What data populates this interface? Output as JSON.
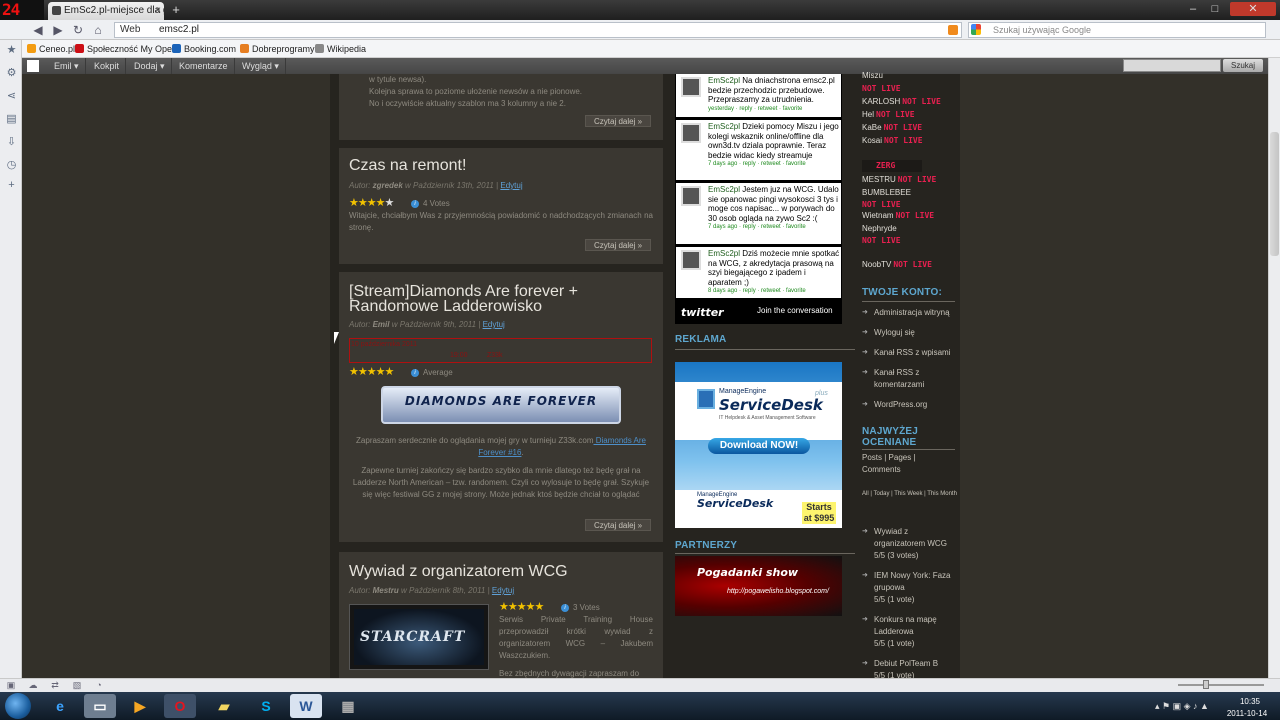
{
  "browser": {
    "tab_title": "EmSc2.pl-miejsce dla g...",
    "tab_close": "×",
    "new_tab": "+",
    "window_controls": [
      "–",
      "□",
      "✕"
    ],
    "app_logo": "24",
    "address_label": "Web",
    "url": "emsc2.pl",
    "search_placeholder": "Szukaj używając Google",
    "bookmarks": [
      {
        "label": "Ceneo.pl",
        "color": "#f39c12"
      },
      {
        "label": "Społeczność My Opera",
        "color": "#cc0f16"
      },
      {
        "label": "Booking.com",
        "color": "#1b63b8"
      },
      {
        "label": "Dobreprogramy",
        "color": "#e67e22"
      },
      {
        "label": "Wikipedia",
        "color": "#888888"
      }
    ]
  },
  "admin_bar": {
    "items": [
      "Emil ▾",
      "Kokpit",
      "Dodaj ▾",
      "Komentarze",
      "Wygląd ▾"
    ],
    "search_button": "Szukaj"
  },
  "posts": {
    "top_fragment": {
      "lines": [
        "w tytule newsa).",
        "Kolejna sprawa to poziome ułożenie newsów a nie pionowe.",
        "No i oczywiście aktualny szablon ma 3 kolumny a nie 2."
      ],
      "read_more": "Czytaj dalej »"
    },
    "remont": {
      "title": "Czas na remont!",
      "meta_prefix": "Autor: ",
      "author": "zgredek",
      "meta_date": " w Październik 13th, 2011 | ",
      "edit": "Edytuj",
      "stars_on": "★★★★",
      "stars_off": "★",
      "votes": "4 Votes",
      "text": "Witajcie, chciałbym Was z przyjemnością powiadomić o nadchodzących zmianach na stronę.",
      "read_more": "Czytaj dalej »"
    },
    "stream": {
      "title": "[Stream]Diamonds Are forever + Randomowe Ladderowisko",
      "meta_prefix": "Autor: ",
      "author": "Emil",
      "meta_date": " w Październik 9th, 2011 | ",
      "edit": "Edytuj",
      "box_line1": "10 października 2011",
      "box_line2": "19:00          Z33k",
      "stars_on": "★★★★★",
      "votes": "Average",
      "banner": "DIAMONDS ARE FOREVER",
      "para1": "Zapraszam serdecznie do oglądania mojej gry w turnieju Z33k.com",
      "para1_link": " Diamonds Are Forever #16",
      "para1_end": ".",
      "para2": "Zapewne turniej zakończy się bardzo szybko dla mnie dlatego też będę grał na Ladderze North American – tzw. randomem. Czyli co wylosuje to będę grał. Szykuje się więc festiwal GG z mojej strony.  Może jednak ktoś będzie chciał to oglądać",
      "read_more": "Czytaj dalej »"
    },
    "wcg": {
      "title": "Wywiad z organizatorem WCG",
      "meta_prefix": "Autor: ",
      "author": "Mestru",
      "meta_date": " w Październik 8th, 2011 | ",
      "edit": "Edytuj",
      "stars_on": "★★★★★",
      "votes": "3 Votes",
      "thumb_text": "STARCRAFT",
      "text": "Serwis Private Training House przeprowadził krótki wywiad z organizatorem WCG – Jakubem Waszczukiem.",
      "text2": "Bez zbędnych dywagacji zapraszam do"
    }
  },
  "twitter": {
    "tweets": [
      {
        "user": "EmSc2pl",
        "text": " Na dniachstrona emsc2.pl bedzie przechodzic przebudowe. Przepraszamy za utrudnienia.",
        "meta": "yesterday · reply · retweet · favorite"
      },
      {
        "user": "EmSc2pl",
        "text": " Dzieki pomocy Miszu i jego kolegi wskaznik online/offline dla own3d.tv dziala poprawnie. Teraz bedzie widac kiedy streamuje",
        "meta": "7 days ago · reply · retweet · favorite"
      },
      {
        "user": "EmSc2pl",
        "text": " Jestem juz na WCG. Udalo sie opanowac pingi wysokosci 3 tys i moge cos napisac... w porywach do 30 osob ogląda na zywo Sc2 :(",
        "meta": "7 days ago · reply · retweet · favorite"
      },
      {
        "user": "EmSc2pl",
        "text": " Dziś możecie mnie spotkać na WCG, z akredytacja prasową na szyi biegającego z ipadem i aparatem ;)",
        "meta": "8 days ago · reply · retweet · favorite"
      }
    ],
    "logo": "twitter",
    "join": "Join the conversation"
  },
  "reklama": {
    "heading": "REKLAMA",
    "brand": "ManageEngine",
    "product": "ServiceDesk",
    "plus": "plus",
    "tagline": "IT Helpdesk & Asset Management Software",
    "download": "Download NOW!",
    "price": "Starts at $995"
  },
  "partnerzy": {
    "heading": "PARTNERZY",
    "banner_text": "Pogadanki show",
    "url": "http://pogawelisho.blogspot.com/"
  },
  "streamers": {
    "top_cut": "Miszu",
    "not_live": "NOT LIVE",
    "list1": [
      "KARLOSH",
      "Hel",
      "KaBe",
      "Kosai"
    ],
    "race": "ZERG",
    "list2": [
      "MESTRU",
      "BUMBLEBEE",
      "Wietnam",
      "Nephryde",
      "NoobTV"
    ]
  },
  "account": {
    "heading": "TWOJE KONTO:",
    "links": [
      "Administracja witryną",
      "Wyloguj się",
      "Kanał RSS z wpisami",
      "Kanał RSS z komentarzami",
      "WordPress.org"
    ]
  },
  "top_rated": {
    "heading": "NAJWYŻEJ OCENIANE",
    "tabs": "Posts | Pages | Comments",
    "filters": "All | Today | This Week | This Month",
    "items": [
      {
        "title": "Wywiad z organizatorem WCG",
        "score": "5/5 (3 votes)"
      },
      {
        "title": "IEM Nowy York: Faza grupowa",
        "score": "5/5 (1 vote)"
      },
      {
        "title": "Konkurs na mapę Ladderowa",
        "score": "5/5 (1 vote)"
      },
      {
        "title": "Debiut PolTeam B",
        "score": "5/5 (1 vote)"
      }
    ]
  },
  "taskbar": {
    "time": "10:35",
    "date": "2011-10-14"
  }
}
